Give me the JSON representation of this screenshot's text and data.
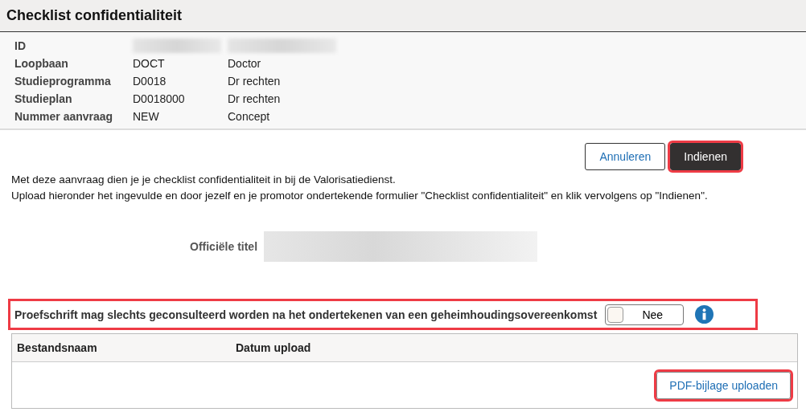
{
  "page": {
    "title": "Checklist confidentialiteit"
  },
  "info": [
    {
      "label": "ID",
      "code_redacted": true,
      "description_redacted": true
    },
    {
      "label": "Loopbaan",
      "code": "DOCT",
      "description": "Doctor"
    },
    {
      "label": "Studieprogramma",
      "code": "D0018",
      "description": "Dr rechten"
    },
    {
      "label": "Studieplan",
      "code": "D0018000",
      "description": "Dr rechten"
    },
    {
      "label": "Nummer aanvraag",
      "code": "NEW",
      "description": "Concept"
    }
  ],
  "buttons": [
    {
      "label": "Annuleren",
      "kind": "secondary",
      "highlighted": false
    },
    {
      "label": "Indienen",
      "kind": "primary",
      "highlighted": true
    }
  ],
  "intro": [
    "Met deze aanvraag dien je je checklist confidentialiteit in bij de Valorisatiedienst.",
    "Upload hieronder het ingevulde en door jezelf en je promotor ondertekende formulier \"Checklist confidentialiteit\" en klik vervolgens op \"Indienen\"."
  ],
  "title_field": {
    "label": "Officiële titel",
    "redacted": true
  },
  "confidential": {
    "label": "Proefschrift mag slechts geconsulteerd worden na het ondertekenen van een geheimhoudingsovereenkomst",
    "highlighted": true,
    "toggle": {
      "on": false,
      "label": "Nee"
    }
  },
  "table": {
    "columns": [
      "Bestandsnaam",
      "Datum upload"
    ],
    "upload": {
      "label": "PDF-bijlage uploaden",
      "highlighted": true
    }
  }
}
